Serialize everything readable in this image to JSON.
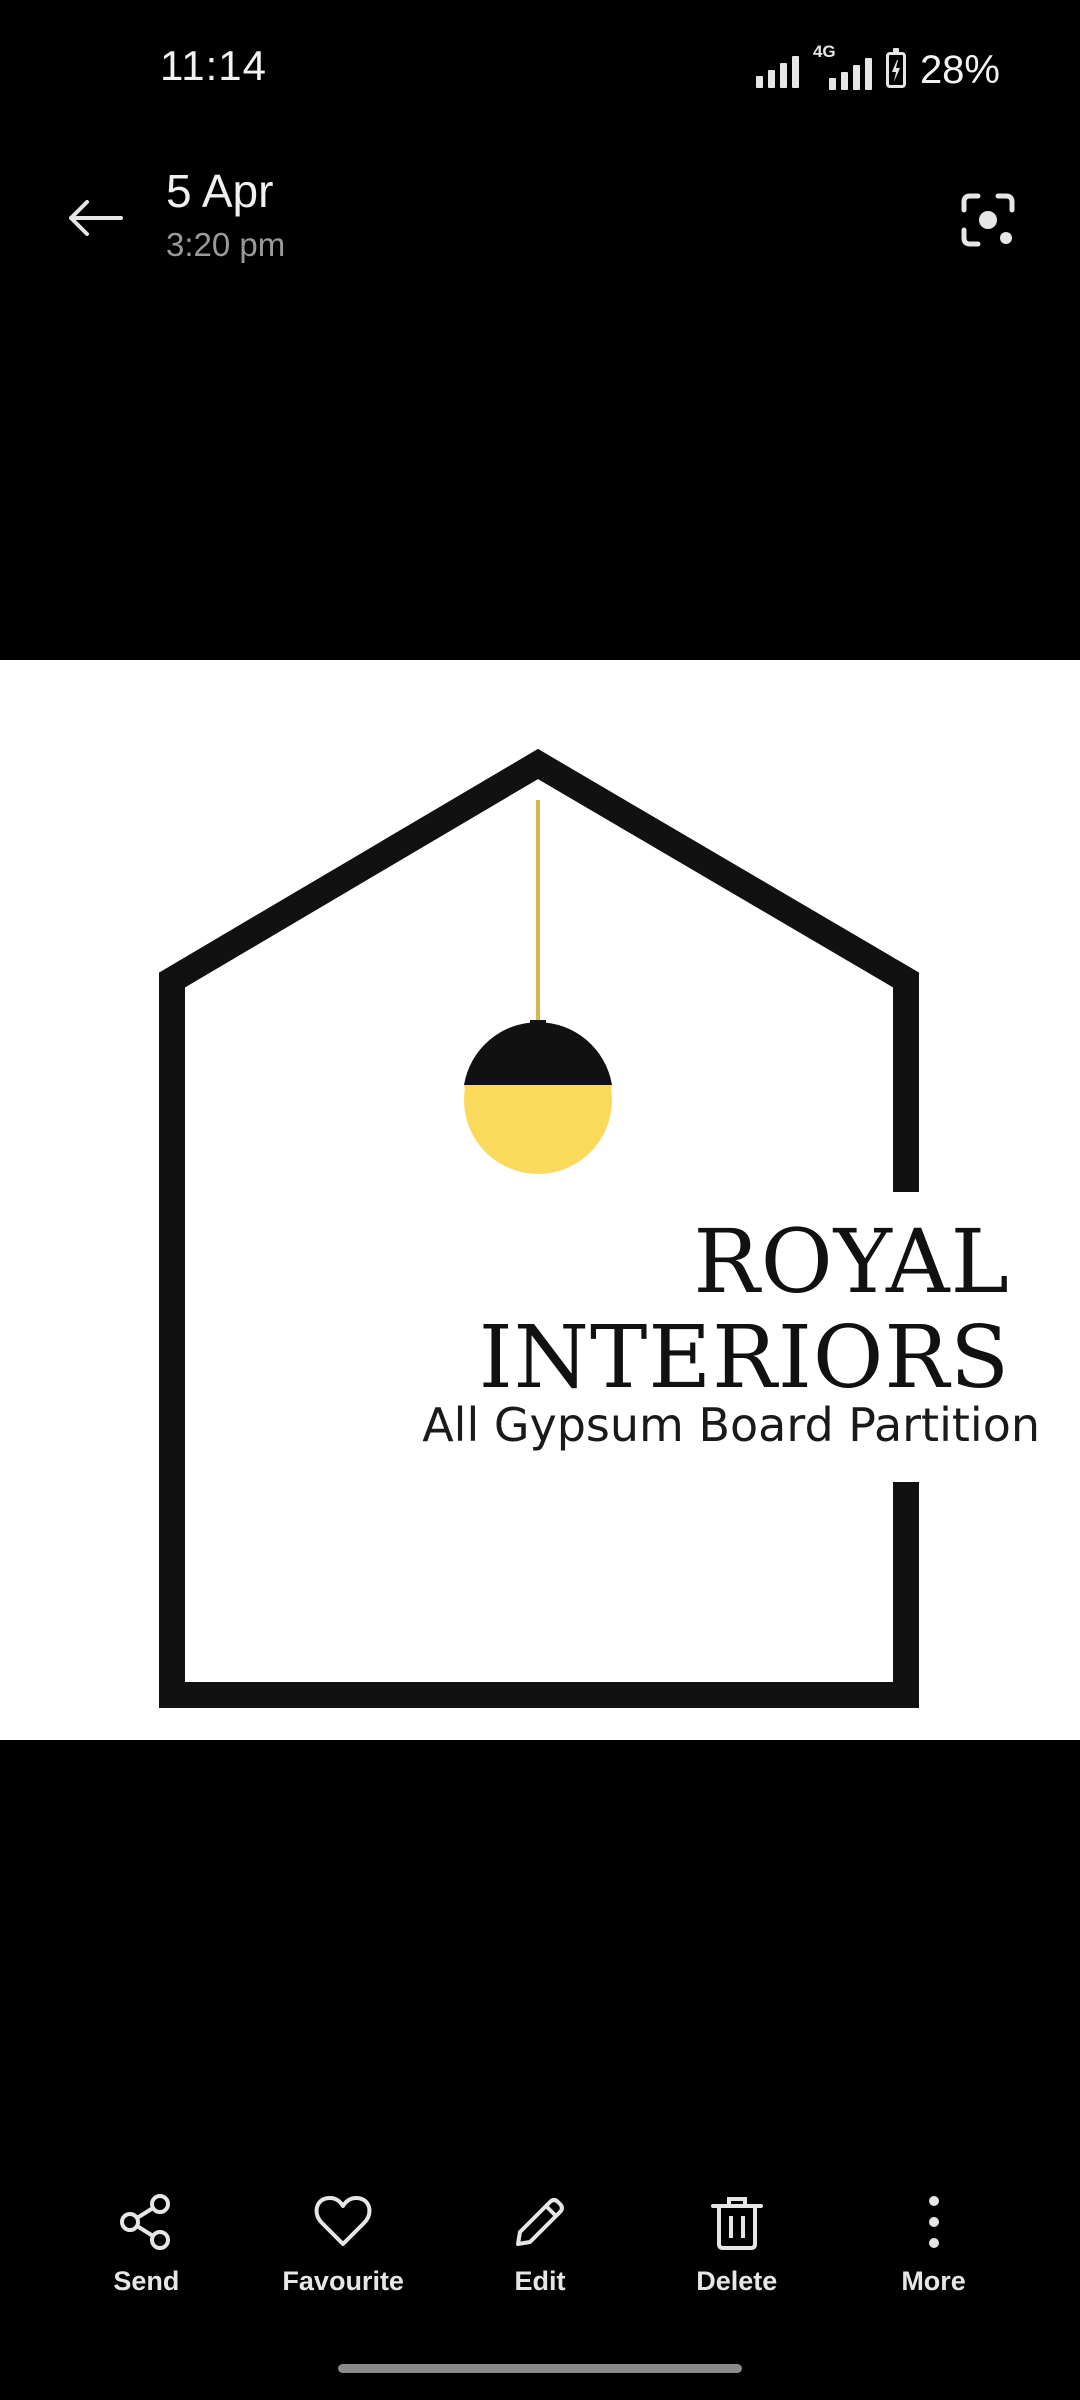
{
  "status_bar": {
    "time": "11:14",
    "network_type": "4G",
    "battery_percent": "28%",
    "battery_level": 0.28
  },
  "header": {
    "date": "5 Apr",
    "time": "3:20 pm",
    "back_icon": "arrow-left-icon",
    "lens_icon": "lens-scan-icon"
  },
  "photo": {
    "brand_line1": "ROYAL",
    "brand_line2": "INTERIORS",
    "tagline": "All Gypsum Board Partition",
    "colors": {
      "frame": "#111111",
      "lamp_wire": "#d9b44a",
      "lamp_glass": "#fbd95a",
      "lamp_cap": "#111111"
    }
  },
  "actions": [
    {
      "label": "Send",
      "icon": "share-icon"
    },
    {
      "label": "Favourite",
      "icon": "heart-icon"
    },
    {
      "label": "Edit",
      "icon": "pencil-icon"
    },
    {
      "label": "Delete",
      "icon": "trash-icon"
    },
    {
      "label": "More",
      "icon": "more-vertical-icon"
    }
  ]
}
